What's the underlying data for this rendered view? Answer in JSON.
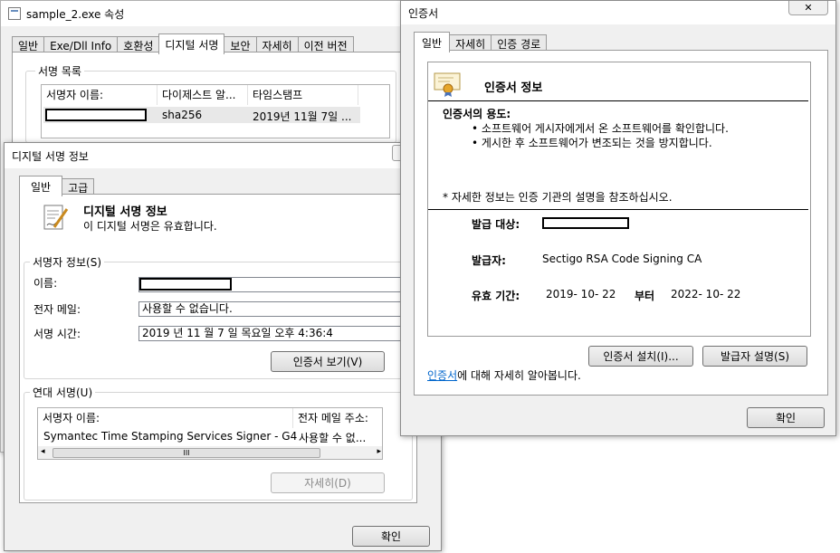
{
  "props_window": {
    "title": "sample_2.exe 속성",
    "tabs": [
      "일반",
      "Exe/Dll Info",
      "호환성",
      "디지털 서명",
      "보안",
      "자세히",
      "이전 버전"
    ],
    "active_tab": "디지털 서명",
    "sig_list_label": "서명 목록",
    "columns": [
      "서명자 이름:",
      "다이제스트 알...",
      "타임스탬프"
    ],
    "row": {
      "digest": "sha256",
      "timestamp": "2019년 11월 7일 ..."
    }
  },
  "sig_info_window": {
    "title": "디지털 서명 정보",
    "help_glyph": "?",
    "tabs": [
      "일반",
      "고급"
    ],
    "heading": "디지털 서명 정보",
    "status": "이 디지털 서명은 유효합니다.",
    "signer_group": "서명자 정보(S)",
    "name_label": "이름:",
    "email_label": "전자 메일:",
    "email_value": "사용할 수 없습니다.",
    "time_label": "서명 시간:",
    "time_value": "2019  년  11  월  7  일   목요일 오후 4:36:4",
    "view_cert_button": "인증서 보기(V)",
    "countersig_group": "연대 서명(U)",
    "cs_columns": [
      "서명자 이름:",
      "전자 메일 주소:"
    ],
    "cs_row": {
      "name": "Symantec Time Stamping Services Signer - G4",
      "email": "사용할 수 없..."
    },
    "scroll_grip": "III",
    "details_button": "자세히(D)",
    "ok_button": "확인"
  },
  "cert_window": {
    "title": "인증서",
    "close_glyph": "✕",
    "tabs": [
      "일반",
      "자세히",
      "인증 경로"
    ],
    "heading": "인증서 정보",
    "purpose_label": "인증서의 용도:",
    "purposes": [
      "소프트웨어 게시자에게서 온 소프트웨어를 확인합니다.",
      "게시한 후 소프트웨어가 변조되는 것을 방지합니다."
    ],
    "note": "* 자세한 정보는 인증 기관의 설명을 참조하십시오.",
    "issued_to_label": "발급 대상:",
    "issuer_label": "발급자:",
    "issuer_value": "Sectigo RSA Code Signing CA",
    "validity_label": "유효 기간:",
    "valid_from": "2019-  10-  22",
    "valid_sep": "부터",
    "valid_to": "2022-  10-  22",
    "install_button": "인증서 설치(I)...",
    "issuer_stmt_button": "발급자 설명(S)",
    "learn_link": "인증서",
    "learn_rest": "에 대해 자세히 알아봅니다.",
    "ok_button": "확인",
    "link_color": "#0066cc"
  }
}
